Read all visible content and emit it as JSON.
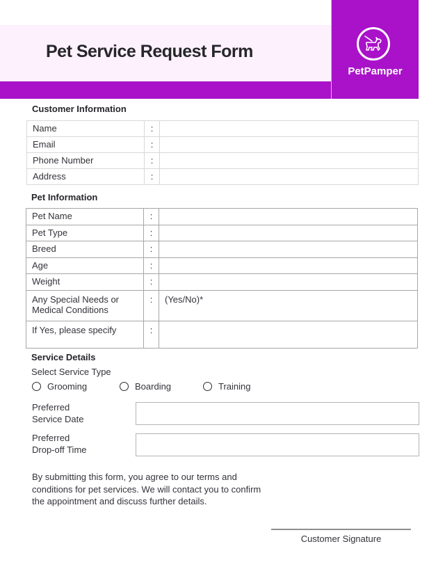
{
  "header": {
    "title": "Pet Service Request Form",
    "brand": "PetPamper",
    "logo_icon": "dog-on-leash-icon",
    "accent_color": "#a912c9",
    "band_color": "#fcf1fc"
  },
  "customer": {
    "section_title": "Customer Information",
    "rows": [
      {
        "label": "Name",
        "sep": ":",
        "value": ""
      },
      {
        "label": "Email",
        "sep": ":",
        "value": ""
      },
      {
        "label": "Phone Number",
        "sep": ":",
        "value": ""
      },
      {
        "label": "Address",
        "sep": ":",
        "value": ""
      }
    ]
  },
  "pet": {
    "section_title": "Pet Information",
    "rows": [
      {
        "label": "Pet Name",
        "sep": ":",
        "value": ""
      },
      {
        "label": "Pet Type",
        "sep": ":",
        "value": ""
      },
      {
        "label": "Breed",
        "sep": ":",
        "value": ""
      },
      {
        "label": "Age",
        "sep": ":",
        "value": ""
      },
      {
        "label": "Weight",
        "sep": ":",
        "value": ""
      },
      {
        "label": "Any Special Needs or Medical Conditions",
        "sep": ":",
        "value": "(Yes/No)*"
      },
      {
        "label": "If Yes, please specify",
        "sep": ":",
        "value": ""
      }
    ]
  },
  "service": {
    "section_title": "Service Details",
    "select_label": "Select Service Type",
    "options": [
      "Grooming",
      "Boarding",
      "Training"
    ],
    "date_label_line1": "Preferred",
    "date_label_line2": "Service Date",
    "date_value": "",
    "time_label_line1": "Preferred",
    "time_label_line2": "Drop-off Time",
    "time_value": ""
  },
  "footer": {
    "terms": "By submitting this form, you agree to our terms and conditions for pet services. We will contact you to confirm the appointment and discuss further details.",
    "signature_label": "Customer Signature"
  }
}
